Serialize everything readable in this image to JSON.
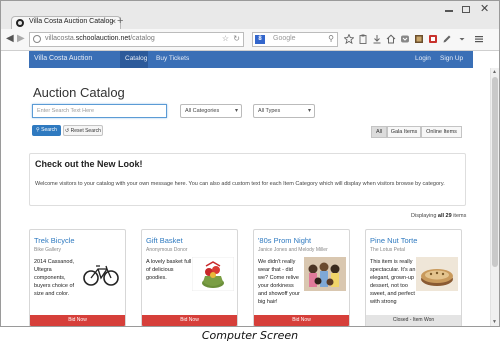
{
  "browser": {
    "tab_title": "Villa Costa Auction Catalog",
    "tab_close": "×",
    "new_tab": "+",
    "window_close": "✕",
    "nav_back": "◀",
    "nav_forward": "▶",
    "url_prefix": "villacosta.",
    "url_domain": "schoolauction.net",
    "url_path": "/catalog",
    "search_engine_badge": "8",
    "search_placeholder": "Google",
    "star_icon": "☆",
    "reload_icon": "↻",
    "search_icon": "⚲"
  },
  "site_nav": {
    "brand": "Villa Costa Auction",
    "links": [
      "Catalog",
      "Buy Tickets"
    ],
    "right_links": [
      "Login",
      "Sign Up"
    ]
  },
  "page": {
    "heading": "Auction Catalog",
    "search_placeholder": "Enter Search Text Here",
    "category_select": "All Categories",
    "type_select": "All Types",
    "search_button": "Search",
    "reset_button": "Reset Search",
    "filters": [
      "All",
      "Gala Items",
      "Online Items"
    ],
    "active_filter": "All",
    "welcome_title": "Check out the New Look!",
    "welcome_text": "Welcome visitors to your catalog with your own message here.  You can also add custom text for each Item Category which will display when visitors browse by category.",
    "displaying_prefix": "Displaying ",
    "displaying_bold": "all 29",
    "displaying_suffix": " items"
  },
  "cards": [
    {
      "title": "Trek Bicycle",
      "sub": "Bike Gallery",
      "desc": "2014 Cassanod, Ultegra components, buyers choice of size and color.",
      "button": "Bid Now",
      "image_icon": "bicycle-photo",
      "status": "open"
    },
    {
      "title": "Gift Basket",
      "sub": "Anonymous Donor",
      "desc": "A lovely basket full of delicious goodies.",
      "button": "Bid Now",
      "image_icon": "gift-basket-photo",
      "status": "open"
    },
    {
      "title": "'80s Prom Night",
      "sub": "Janice Jones and Melody Miller",
      "desc": "We didn't really wear that - did we? Come relive your dorkiness and showoff your big hair!",
      "button": "Bid Now",
      "image_icon": "group-photo",
      "status": "open"
    },
    {
      "title": "Pine Nut Torte",
      "sub": "The Lotus Petal",
      "desc": "This item is really spectacular. It's an elegant, grown-up dessert, not too sweet, and perfect with strong",
      "button": "Closed - Item Won",
      "image_icon": "torte-photo",
      "status": "closed"
    }
  ],
  "caption": "Computer Screen",
  "colors": {
    "nav_blue": "#3a6fb6",
    "link_blue": "#2f7ac0",
    "bid_red": "#d63f3a"
  }
}
